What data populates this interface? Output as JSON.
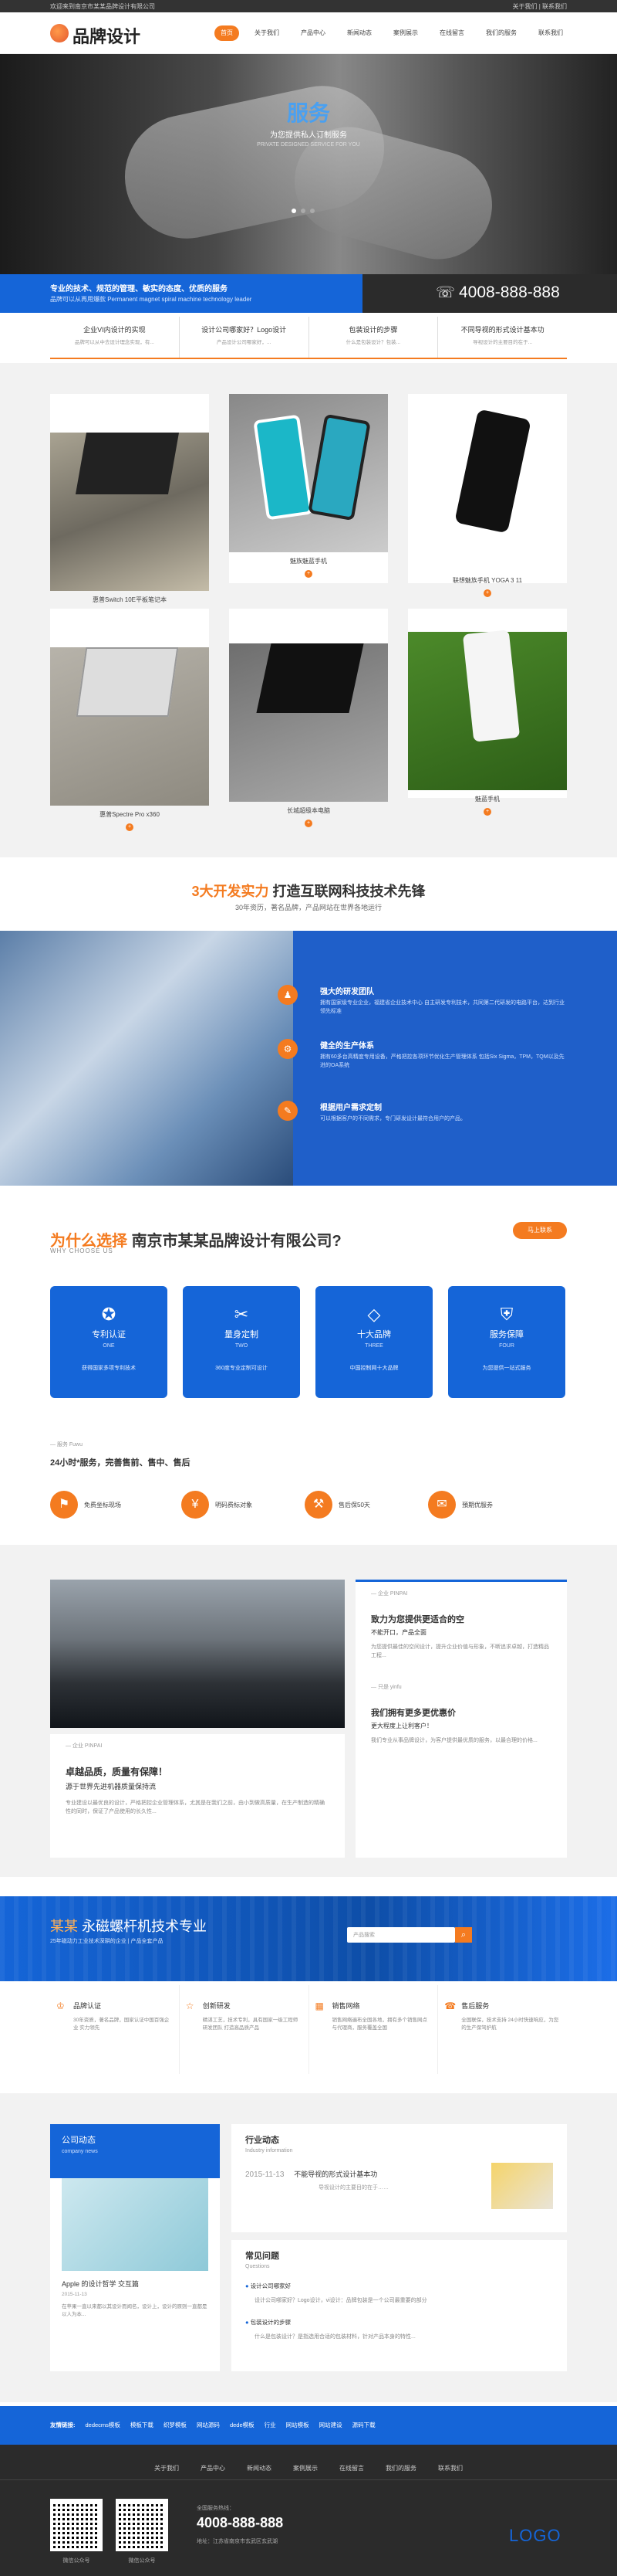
{
  "topbar": {
    "welcome": "欢迎来到南京市某某品牌设计有限公司",
    "links": "关于我们 | 联系我们"
  },
  "header": {
    "logo_text": "品牌设计"
  },
  "nav": {
    "items": [
      "首页",
      "关于我们",
      "产品中心",
      "新闻动态",
      "案例展示",
      "在线留言",
      "我们的服务",
      "联系我们"
    ]
  },
  "banner": {
    "title": "服务",
    "sub": "为您提供私人订制服务",
    "sub2": "PRIVATE DESIGNED SERVICE FOR YOU"
  },
  "blueband": {
    "line1": "专业的技术、规范的管理、敏实的态度、优质的服务",
    "line2": "品牌可以从再用爆款 Permanent magnet spiral machine technology leader"
  },
  "phone": "4008-888-888",
  "services": [
    {
      "title": "企业VI内设计的实现",
      "desc": "品牌可以从中去设计理念实现，有..."
    },
    {
      "title": "设计公司哪家好？Logo设计",
      "desc": "产品设计公司哪家好，..."
    },
    {
      "title": "包装设计的步骤",
      "desc": "什么是包装设计？包装..."
    },
    {
      "title": "不同导视的形式设计基本功",
      "desc": "导视设计的主要目的在于..."
    }
  ],
  "products": [
    {
      "caption": "惠普Switch 10E平板笔记本"
    },
    {
      "caption": "魅族魅蓝手机"
    },
    {
      "caption": "联想魅族手机 YOGA 3 11"
    },
    {
      "caption": "惠普Spectre Pro x360"
    },
    {
      "caption": "长城超级本电脑"
    },
    {
      "caption": "魅蓝手机"
    }
  ],
  "strength": {
    "title_orange": "3大开发实力",
    "title_rest": "打造互联网科技技术先锋",
    "sub": "30年资历，著名品牌，产品网站在世界各地运行"
  },
  "strength_items": [
    {
      "title": "强大的研发团队",
      "desc": "拥有国家级专业企业，福建省企业技术中心 自主研发专利技术，共同第二代研发的电路平台，达到行业领先标准"
    },
    {
      "title": "健全的生产体系",
      "desc": "拥有60多台高精度专用设备，严格把控各项环节优化生产管理体系 包括Six Sigma，TPM，TQM以及先进的OA系统"
    },
    {
      "title": "根据用户需求定制",
      "desc": "可以根据客户的不同需求，专门研发设计最符合用户的产品。"
    }
  ],
  "why": {
    "title_orange": "为什么选择",
    "title_rest": "南京市某某品牌设计有限公司?",
    "sub": "WHY CHOOSE US",
    "button": "马上联系"
  },
  "why_cards": [
    {
      "title": "专利认证",
      "en": "ONE",
      "desc": "获得国家多项专利技术"
    },
    {
      "title": "量身定制",
      "en": "TWO",
      "desc": "360度专业定制可设计"
    },
    {
      "title": "十大品牌",
      "en": "THREE",
      "desc": "中国控制网十大品牌"
    },
    {
      "title": "服务保障",
      "en": "FOUR",
      "desc": "为您提供一站式服务"
    }
  ],
  "fx": {
    "small": "— 服务 Fuwu",
    "title": "24小时*服务，完善售前、售中、售后"
  },
  "fx_items": [
    "免费坐标现场",
    "明码费标对象",
    "售后保50天",
    "預期优服券"
  ],
  "case": {
    "small": "— 企业 PINPAI",
    "title": "卓越品质，质量有保障！",
    "subtitle": "源于世界先进机器质量保持流",
    "desc": "专业建设以最优良的设计，严格把控企业管理体系，尤其是在我们之前，由小到做高质量，在生产制造的精确性的同时，保证了产品使用的长久性..."
  },
  "right_case": {
    "small1": "— 企业 PINPAI",
    "title1": "致力为您提供更适合的空",
    "sub1": "不能开口，产品全面",
    "desc1": "为您提供最佳的空间设计，提升企业价值与形象，不断追求卓越，打造精品工程...",
    "small2": "— 只是 yinfu",
    "title2": "我们拥有更多更优惠价",
    "sub2": "更大程度上让利客户！",
    "desc2": "我们专业从事品牌设计，为客户提供最优质的服务，以最合理的价格..."
  },
  "chain": {
    "title_a": "某某",
    "title_b": "永磁螺杆机技术专业",
    "sub": "25年磁动力工业技术深耕的企业 | 产品全套产品",
    "search_placeholder": "产品搜索"
  },
  "advantages": [
    {
      "title": "品牌认证",
      "desc": "30年资质，著名品牌，国家认证中国百强企业 实力领先"
    },
    {
      "title": "创新研发",
      "desc": "精湛工艺，技术专利，具有国家一级工程师研发团队 打造高品质产品"
    },
    {
      "title": "销售网络",
      "desc": "销售网络遍布全国各地，拥有多个销售网点与代理商，服务覆盖全国"
    },
    {
      "title": "售后服务",
      "desc": "全国联保，技术支持 24小时快速响应，为您的生产保驾护航"
    }
  ],
  "news": {
    "company_title": "公司动态",
    "company_en": "company news",
    "card_title": "Apple 的设计哲学 交互篇",
    "card_date": "2015-11-13",
    "card_desc": "在苹果一直以来都以其设计而闻名，设计上，设计的原则一直都是以人为本...",
    "industry_title": "行业动态",
    "industry_en": "Industry information",
    "industry_date": "2015-11-13",
    "industry_headline": "不能导视的形式设计基本功",
    "industry_desc": "导视设计的主要目的在于……",
    "faq_title": "常见问题",
    "faq_en": "Questions",
    "faq": [
      "设计公司哪家好",
      "设计公司哪家好？Logo设计，vi设计：品牌包装是一个公司最重要的部分",
      "包装设计的步骤",
      "什么是包装设计？是指选用合适的包装材料，针对产品本身的特性..."
    ]
  },
  "friend_links": {
    "label": "友情链接:",
    "items": [
      "dedecms模板",
      "模板下载",
      "织梦模板",
      "网站源码",
      "dede模板",
      "行业",
      "网站模板",
      "网站建设",
      "源码下载"
    ]
  },
  "footer": {
    "nav": [
      "关于我们",
      "产品中心",
      "新闻动态",
      "案例展示",
      "在线留言",
      "我们的服务",
      "联系我们"
    ],
    "qr1": "微信公众号",
    "qr2": "微信公众号",
    "phone_label": "全国服务热线：",
    "phone": "4008-888-888",
    "address": "地址：江苏省南京市玄武区玄武湖",
    "logo": "LOGO"
  },
  "colors": {
    "orange": "#f47b20",
    "blue": "#1565d8",
    "dark": "#2b2b2b"
  }
}
